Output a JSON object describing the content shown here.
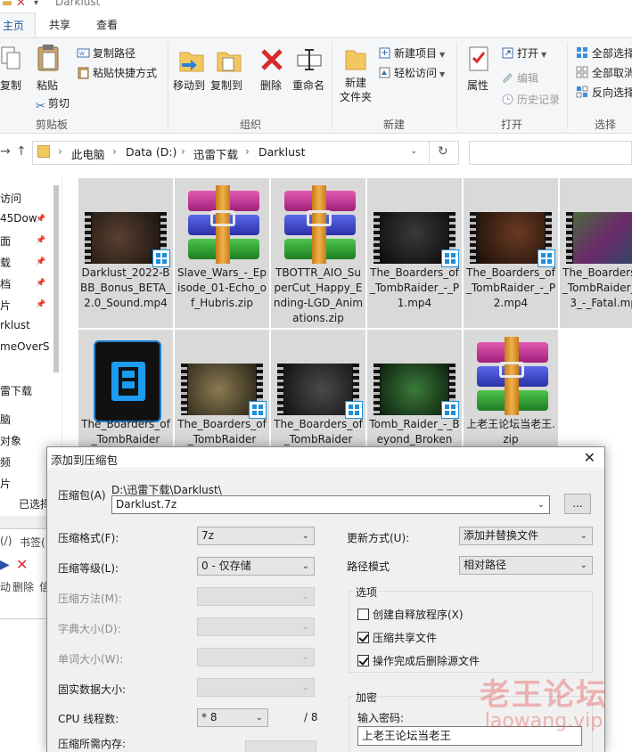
{
  "window": {
    "title": "Darklust"
  },
  "ribbon_tabs": [
    "主页",
    "共享",
    "查看"
  ],
  "ribbon": {
    "clipboard": {
      "copy_label": "复制",
      "paste_label": "粘贴",
      "copy_path": "复制路径",
      "paste_shortcut": "粘贴快捷方式",
      "cut": "剪切",
      "group": "剪贴板"
    },
    "organize": {
      "move_to": "移动到",
      "copy_to": "复制到",
      "delete": "删除",
      "rename": "重命名",
      "group": "组织"
    },
    "new": {
      "new_folder": "新建\n文件夹",
      "new_item": "新建项目",
      "easy_access": "轻松访问",
      "group": "新建"
    },
    "open": {
      "properties": "属性",
      "open": "打开",
      "edit": "编辑",
      "history": "历史记录",
      "group": "打开"
    },
    "select": {
      "select_all": "全部选择",
      "select_none": "全部取消",
      "invert": "反向选择",
      "group": "选择"
    }
  },
  "address": {
    "crumbs": [
      "此电脑",
      "Data (D:)",
      "迅雷下载",
      "Darklust"
    ]
  },
  "nav_items": [
    "访问",
    "45Dow",
    "面",
    "载",
    "档",
    "片",
    "rklust",
    "meOverS",
    "雷下载",
    "脑",
    "对象",
    "频",
    "片"
  ],
  "files": [
    {
      "name": "Darklust_2022-BBB_Bonus_BETA_2.0_Sound.mp4",
      "kind": "video",
      "selected": true
    },
    {
      "name": "Slave_Wars_-_Episode_01-Echo_of_Hubris.zip",
      "kind": "zip",
      "selected": true
    },
    {
      "name": "TBOTTR_AIO_SuperCut_Happy_Ending-LGD_Animations.zip",
      "kind": "zip",
      "selected": true
    },
    {
      "name": "The_Boarders_of_TombRaider_-_P1.mp4",
      "kind": "video",
      "selected": true
    },
    {
      "name": "The_Boarders_of_TombRaider_-_P2.mp4",
      "kind": "video",
      "selected": true
    },
    {
      "name": "The_Boarders_of_TombRaider_-_P3_-_Fatal.mp4",
      "kind": "video",
      "selected": true
    },
    {
      "name": "The_Boarders_of_TombRaider",
      "kind": "videoapp",
      "selected": true
    },
    {
      "name": "The_Boarders_of_TombRaider",
      "kind": "video",
      "selected": true
    },
    {
      "name": "The_Boarders_of_TombRaider",
      "kind": "video",
      "selected": true
    },
    {
      "name": "Tomb_Raider_-_Beyond_Broken",
      "kind": "video",
      "selected": true
    },
    {
      "name": "上老王论坛当老王.zip",
      "kind": "zip",
      "selected": true
    }
  ],
  "explorer_bottom": {
    "selected_text": "已选择",
    "lower_labels": [
      "(/)",
      "书签(",
      "动",
      "删除",
      "信"
    ]
  },
  "dialog": {
    "title": "添加到压缩包",
    "archive_label": "压缩包(A)",
    "archive_path": "D:\\迅雷下载\\Darklust\\",
    "archive_name": "Darklust.7z",
    "browse_label": "...",
    "format_label": "压缩格式(F):",
    "format_value": "7z",
    "level_label": "压缩等级(L):",
    "level_value": "0 - 仅存储",
    "method_label": "压缩方法(M):",
    "dict_label": "字典大小(D):",
    "word_label": "单词大小(W):",
    "solid_label": "固实数据大小:",
    "threads_label": "CPU 线程数:",
    "threads_value": "* 8",
    "threads_max": "/ 8",
    "memory_label": "压缩所需内存:",
    "update_label": "更新方式(U):",
    "update_value": "添加并替换文件",
    "pathmode_label": "路径模式",
    "pathmode_value": "相对路径",
    "options_title": "选项",
    "options": [
      {
        "label": "创建自释放程序(X)",
        "checked": false
      },
      {
        "label": "压缩共享文件",
        "checked": true
      },
      {
        "label": "操作完成后删除源文件",
        "checked": true
      }
    ],
    "encrypt_title": "加密",
    "password_label": "输入密码:",
    "password_value": "上老王论坛当老王"
  },
  "watermark": {
    "line1": "老王论坛",
    "line2": "laowang.vip"
  }
}
